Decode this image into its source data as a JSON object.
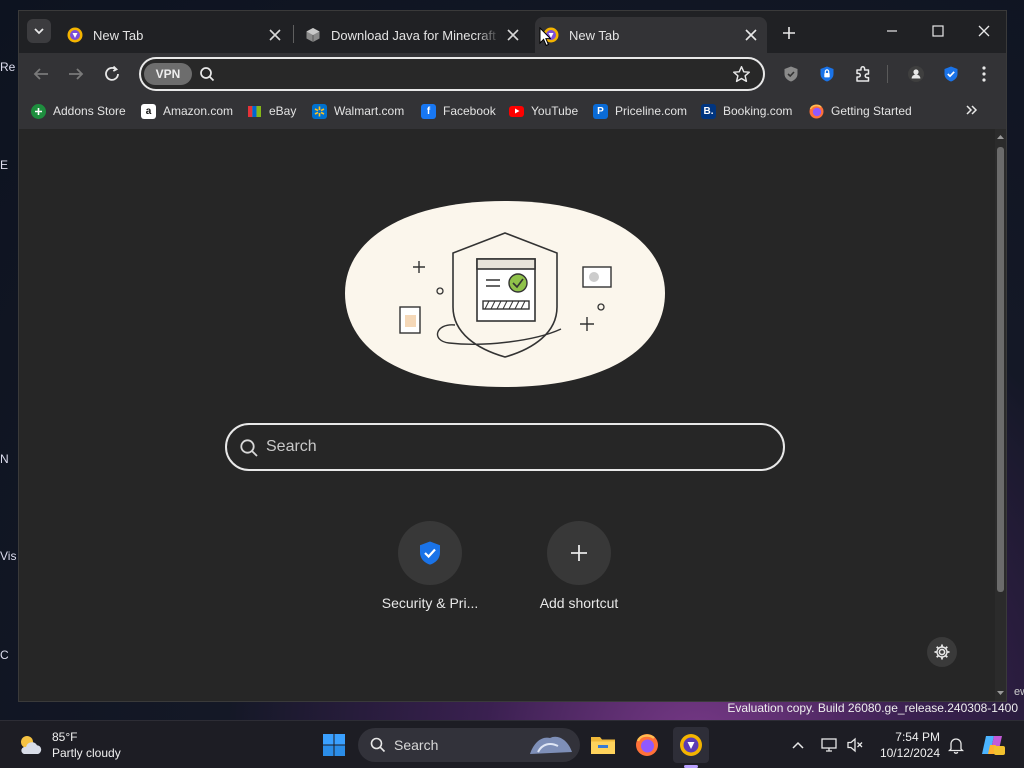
{
  "desktop": {
    "fragments": [
      "Re",
      "E",
      "N",
      "Vis",
      "C"
    ],
    "right_fragment": "ew",
    "watermark": "Evaluation copy. Build 26080.ge_release.240308-1400"
  },
  "tabs": [
    {
      "label": "New Tab",
      "active": false
    },
    {
      "label": "Download Java for Minecraft (R",
      "active": false
    },
    {
      "label": "New Tab",
      "active": true
    }
  ],
  "toolbar": {
    "vpn_label": "VPN",
    "address_value": "",
    "address_placeholder": ""
  },
  "bookmarks": [
    {
      "label": "Addons Store",
      "icon": "addons-store-icon",
      "color": "#1e8e3e"
    },
    {
      "label": "Amazon.com",
      "icon": "amazon-icon",
      "color": "#ffffff"
    },
    {
      "label": "eBay",
      "icon": "ebay-icon",
      "color": "#e53238"
    },
    {
      "label": "Walmart.com",
      "icon": "walmart-icon",
      "color": "#0071ce"
    },
    {
      "label": "Facebook",
      "icon": "facebook-icon",
      "color": "#1877f2"
    },
    {
      "label": "YouTube",
      "icon": "youtube-icon",
      "color": "#ff0000"
    },
    {
      "label": "Priceline.com",
      "icon": "priceline-icon",
      "color": "#0a6bd6"
    },
    {
      "label": "Booking.com",
      "icon": "booking-icon",
      "color": "#003580"
    },
    {
      "label": "Getting Started",
      "icon": "firefox-icon",
      "color": "#ff7139"
    }
  ],
  "page": {
    "search_placeholder": "Search",
    "shortcuts": [
      {
        "label": "Security & Pri...",
        "icon": "shield-check-icon"
      },
      {
        "label": "Add shortcut",
        "icon": "plus-icon"
      }
    ]
  },
  "taskbar": {
    "temperature": "85°F",
    "condition": "Partly cloudy",
    "search_label": "Search",
    "time": "7:54 PM",
    "date": "10/12/2024"
  },
  "colors": {
    "accent_blue": "#1a73e8",
    "page_bg": "#262626",
    "toolbar_bg": "#333336"
  }
}
